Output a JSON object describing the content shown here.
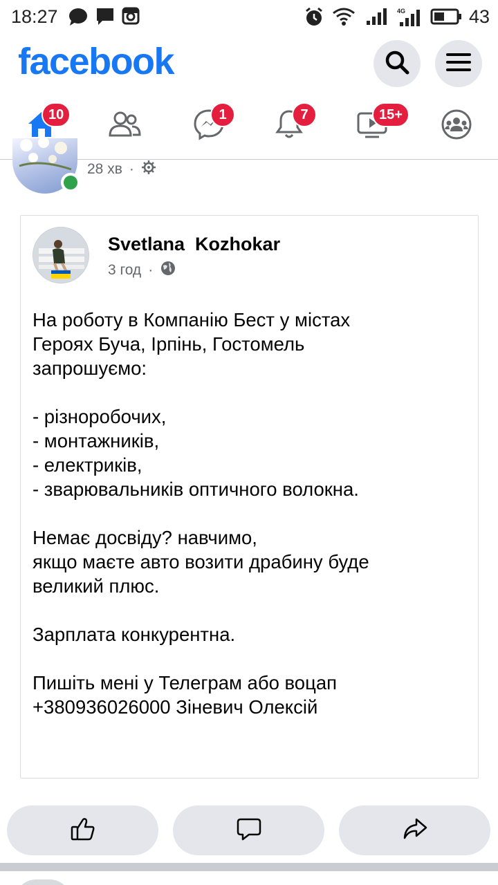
{
  "status_bar": {
    "time": "18:27",
    "network": "4G",
    "battery": "43",
    "icons": [
      "chat-bubble-icon",
      "message-icon",
      "instagram-icon",
      "alarm-icon",
      "wifi-icon",
      "signal-icon",
      "battery-icon"
    ]
  },
  "header": {
    "logo": "facebook",
    "search_icon": "search-icon",
    "menu_icon": "menu-icon"
  },
  "nav": {
    "tabs": [
      {
        "name": "home",
        "icon": "home-icon",
        "badge": "10",
        "active": true
      },
      {
        "name": "friends",
        "icon": "friends-icon",
        "badge": ""
      },
      {
        "name": "messenger",
        "icon": "messenger-icon",
        "badge": "1"
      },
      {
        "name": "notifications",
        "icon": "bell-icon",
        "badge": "7"
      },
      {
        "name": "watch",
        "icon": "watch-icon",
        "badge": "15+"
      },
      {
        "name": "groups",
        "icon": "groups-icon",
        "badge": ""
      }
    ],
    "active_color": "#1877f2",
    "badge_color": "#e41e3f"
  },
  "prev_post": {
    "time": "28 хв",
    "separator": "·"
  },
  "post": {
    "author": "Svetlana  Kozhokar",
    "time": "3 год",
    "separator": "·",
    "lines": [
      "На роботу в Компанію Бест у містах",
      "Героях Буча, Ірпінь, Гостомель",
      "запрошуємо:",
      "",
      "- різноробочих,",
      "- монтажників,",
      "- електриків,",
      "- зварювальників оптичного волокна.",
      "",
      "Немає досвіду? навчимо,",
      "якщо маєте авто возити драбину буде",
      "великий плюс.",
      "",
      "Зарплата конкурентна.",
      "",
      "Пишіть мені у Телеграм або воцап",
      "+380936026000 Зіневич Олексій"
    ]
  },
  "actions": [
    "like-icon",
    "comment-icon",
    "share-icon"
  ]
}
